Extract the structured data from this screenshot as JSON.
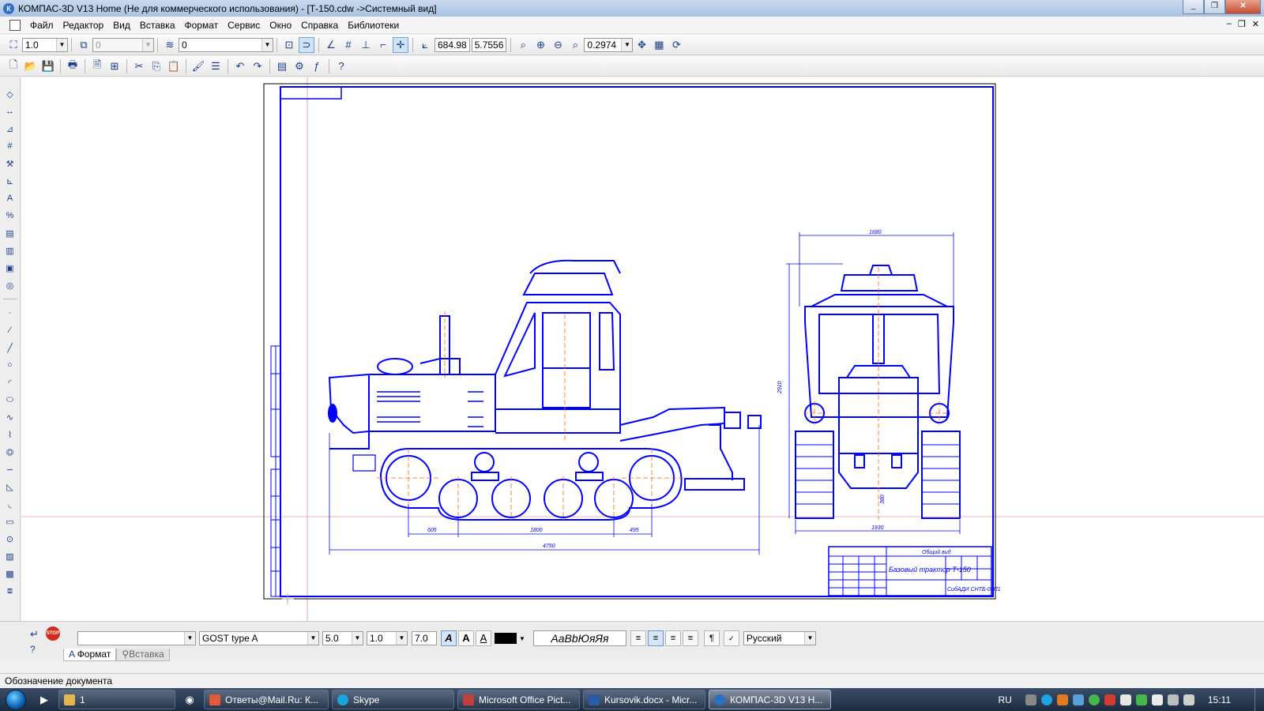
{
  "window": {
    "title": "КОМПАС-3D V13 Home (Не для коммерческого использования) - [Т-150.cdw ->Системный вид]",
    "app_icon_letter": "К"
  },
  "menu": [
    "Файл",
    "Редактор",
    "Вид",
    "Вставка",
    "Формат",
    "Сервис",
    "Окно",
    "Справка",
    "Библиотеки"
  ],
  "toolbar1": {
    "scale": "1.0",
    "layer": "0",
    "style": "0",
    "coord_x": "684.98",
    "coord_y": "5.7556",
    "zoom": "0.2974"
  },
  "drawing": {
    "title_block_name": "Базовый трактор Т-150",
    "title_block_org": "СибАДИ  СНТБ-09П1",
    "title_block_header": "Общий вид",
    "dims": {
      "front_width": "1680",
      "front_track": "1930",
      "side_total": "4750",
      "side_left": "605",
      "side_mid": "1800",
      "side_right": "495",
      "height": "2910",
      "ground": "380"
    }
  },
  "propbar": {
    "font": "GOST type A",
    "size": "5.0",
    "narrow": "1.0",
    "step": "7.0",
    "sample": "АаВbЮяЯя",
    "language": "Русский",
    "tab_format": "Формат",
    "tab_insert": "Вставка"
  },
  "status": "Обозначение документа",
  "taskbar": {
    "items": [
      {
        "label": "1",
        "color": "#e2b54d"
      },
      {
        "label": "Ответы@Mail.Ru: К...",
        "color": "#e25a3a"
      },
      {
        "label": "Skype",
        "color": "#1ba4e0"
      },
      {
        "label": "Microsoft Office Pict...",
        "color": "#c23f3f"
      },
      {
        "label": "Kursovik.docx - Micr...",
        "color": "#2b5ca8"
      },
      {
        "label": "КОМПАС-3D V13 Н...",
        "color": "#2d6fc3"
      }
    ],
    "lang": "RU",
    "time": "15:11"
  }
}
